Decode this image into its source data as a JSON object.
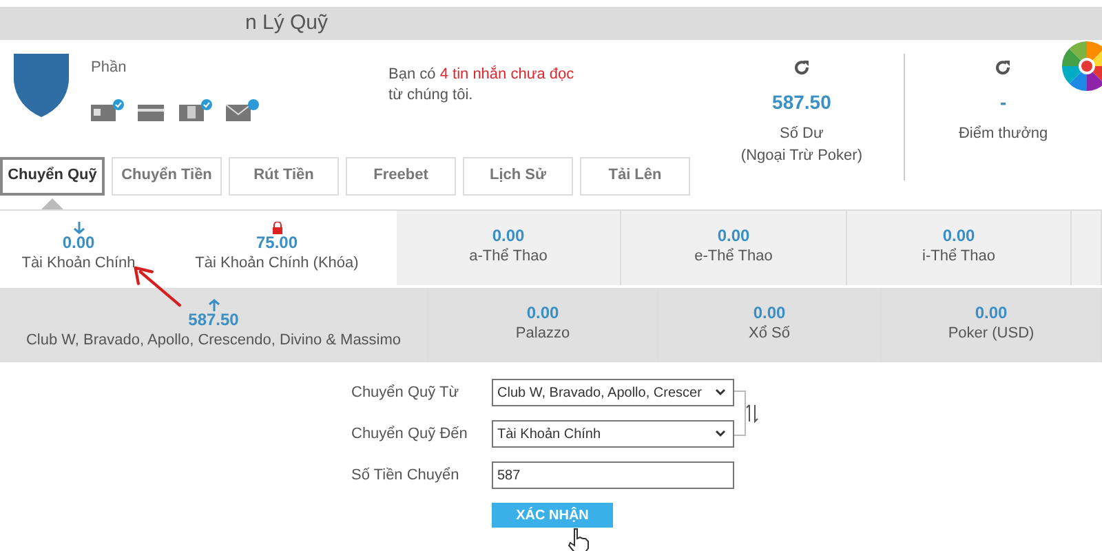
{
  "header": {
    "title": "n Lý Quỹ"
  },
  "profile": {
    "name_fragment": "Phần"
  },
  "message": {
    "prefix": "Bạn có",
    "highlight": "4 tin nhắn chưa đọc",
    "line2": "từ chúng tôi."
  },
  "balance": {
    "amount": "587.50",
    "label": "Số Dư",
    "note": "(Ngoại Trừ Poker)"
  },
  "points": {
    "amount": "-",
    "label": "Điểm thưởng"
  },
  "tabs": [
    {
      "label": "Chuyển Quỹ",
      "selected": true
    },
    {
      "label": "Chuyển Tiền",
      "selected": false
    },
    {
      "label": "Rút Tiền",
      "selected": false
    },
    {
      "label": "Freebet",
      "selected": false
    },
    {
      "label": "Lịch Sử",
      "selected": false
    },
    {
      "label": "Tải Lên",
      "selected": false
    }
  ],
  "wallet_rows": [
    {
      "cells": [
        {
          "kind": "main",
          "amount": "0.00",
          "label": "Tài Khoản Chính",
          "selected": true
        },
        {
          "kind": "locked",
          "amount": "75.00",
          "label": "Tài Khoản Chính (Khóa)",
          "selected": false
        },
        {
          "kind": "product",
          "amount": "0.00",
          "label": "a-Thể Thao",
          "selected": false
        },
        {
          "kind": "product",
          "amount": "0.00",
          "label": "e-Thể Thao",
          "selected": false
        },
        {
          "kind": "product",
          "amount": "0.00",
          "label": "i-Thể Thao",
          "selected": false
        }
      ]
    },
    {
      "cells": [
        {
          "kind": "source",
          "amount": "587.50",
          "label": "Club W, Bravado, Apollo, Crescendo, Divino & Massimo",
          "selected": false
        },
        {
          "kind": "product",
          "amount": "0.00",
          "label": "Palazzo",
          "selected": false
        },
        {
          "kind": "product",
          "amount": "0.00",
          "label": "Xổ Số",
          "selected": false
        },
        {
          "kind": "product",
          "amount": "0.00",
          "label": "Poker (USD)",
          "selected": false
        }
      ]
    }
  ],
  "form": {
    "fields": [
      {
        "kind": "select",
        "label": "Chuyển Quỹ Từ",
        "value": "Club W, Bravado, Apollo, Crescer"
      },
      {
        "kind": "select",
        "label": "Chuyển Quỹ Đến",
        "value": "Tài Khoản Chính"
      },
      {
        "kind": "input",
        "label": "Số Tiền Chuyển",
        "value": "587"
      }
    ],
    "submit": "XÁC NHẬN"
  }
}
